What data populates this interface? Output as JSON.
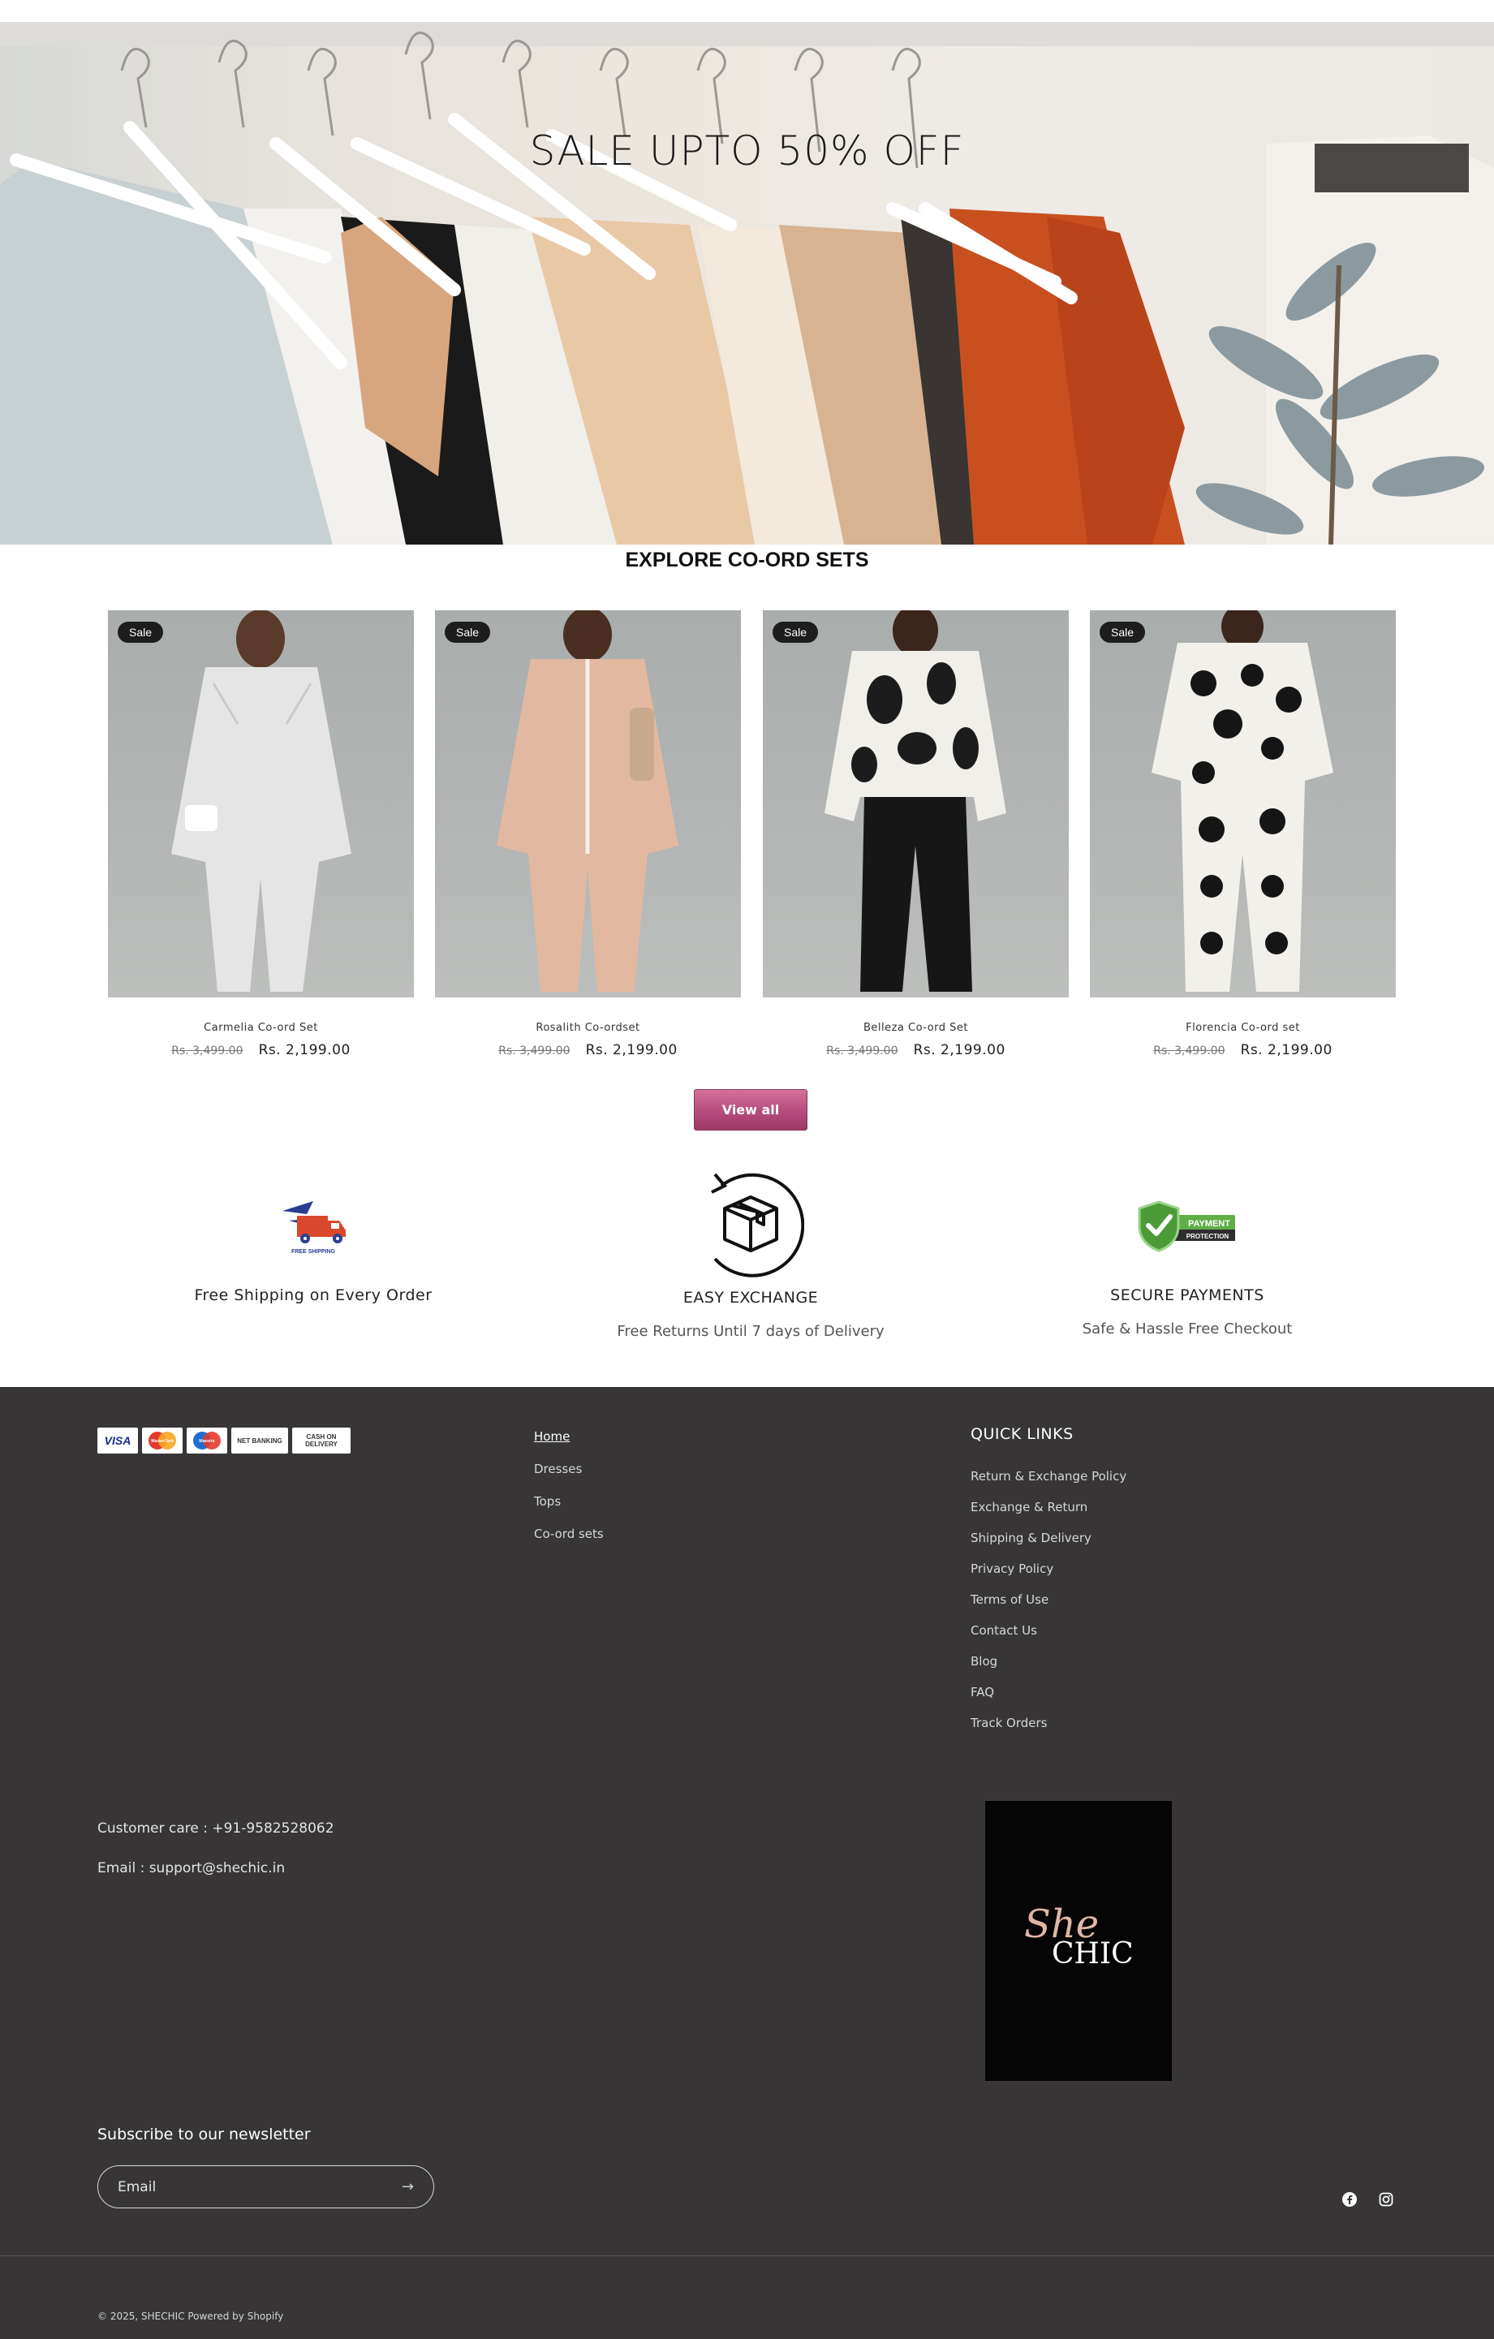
{
  "hero": {
    "title": "SALE UPTO 50% OFF"
  },
  "collection": {
    "title": "EXPLORE CO-ORD SETS",
    "products": [
      {
        "badge": "Sale",
        "name": "Carmelia Co-ord Set",
        "old_price": "Rs. 3,499.00",
        "price": "Rs. 2,199.00"
      },
      {
        "badge": "Sale",
        "name": "Rosalith Co-ordset",
        "old_price": "Rs. 3,499.00",
        "price": "Rs. 2,199.00"
      },
      {
        "badge": "Sale",
        "name": "Belleza Co-ord Set",
        "old_price": "Rs. 3,499.00",
        "price": "Rs. 2,199.00"
      },
      {
        "badge": "Sale",
        "name": "Florencia Co-ord set",
        "old_price": "Rs. 3,499.00",
        "price": "Rs. 2,199.00"
      }
    ],
    "view_all": "View all"
  },
  "features": [
    {
      "icon": "free-shipping-truck-icon",
      "icon_label": "FREE SHIPPING",
      "title": "Free Shipping on Every Order",
      "subtitle": ""
    },
    {
      "icon": "exchange-box-icon",
      "title": "EASY EXCHANGE",
      "subtitle": "Free Returns Until 7 days of Delivery"
    },
    {
      "icon": "payment-protection-shield-icon",
      "icon_label": "PAYMENT",
      "icon_sublabel": "PROTECTION",
      "title": "SECURE PAYMENTS",
      "subtitle": "Safe & Hassle Free Checkout"
    }
  ],
  "footer": {
    "payment_methods": [
      "VISA",
      "MasterCard",
      "Maestro",
      "NET BANKING",
      "CASH ON DELIVERY"
    ],
    "nav": [
      "Home",
      "Dresses",
      "Tops",
      "Co-ord sets"
    ],
    "quick_links_title": "QUICK LINKS",
    "quick_links": [
      "Return & Exchange Policy",
      "Exchange & Return",
      "Shipping & Delivery",
      "Privacy Policy",
      "Terms of Use",
      "Contact Us",
      "Blog",
      "FAQ",
      "Track Orders"
    ],
    "customer_care": "Customer care : +91-9582528062",
    "email_contact": "Email : support@shechic.in",
    "logo_text_1": "She",
    "logo_text_2": "CHIC",
    "newsletter_title": "Subscribe to our newsletter",
    "email_placeholder": "Email",
    "copyright": "© 2025, SHECHIC Powered by Shopify"
  },
  "colors": {
    "footer_bg": "#373536",
    "button_pink": "#b3497a",
    "badge_bg": "#1d1d1d"
  }
}
